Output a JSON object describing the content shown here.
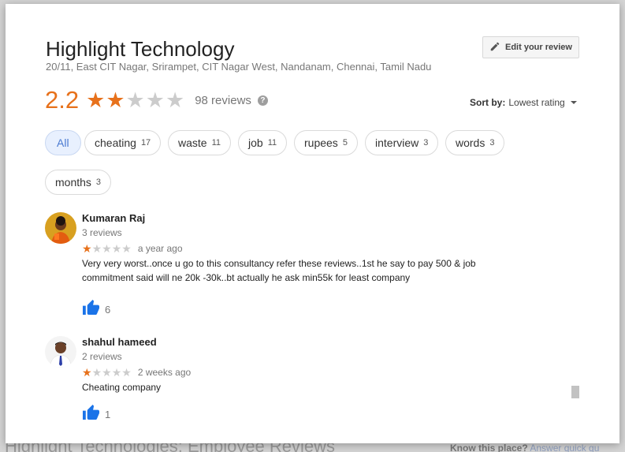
{
  "background": {
    "title": "Highlight Technologies: Employee Reviews ...",
    "know_label": "Know this place?",
    "know_link": "Answer quick qu"
  },
  "business": {
    "name": "Highlight Technology",
    "address": "20/11, East CIT Nagar, Srirampet, CIT Nagar West, Nandanam, Chennai, Tamil Nadu",
    "rating": "2.2",
    "rating_value": 2.2,
    "review_count": "98 reviews"
  },
  "edit_button": {
    "label": "Edit your review",
    "icon": "pencil-icon"
  },
  "sort": {
    "label": "Sort by:",
    "value": "Lowest rating"
  },
  "colors": {
    "star": "#e7711b",
    "star_empty": "#cccccc",
    "like": "#1a73e8",
    "chip_active": "#4a7ad1"
  },
  "filters": [
    {
      "label": "All",
      "count": ""
    },
    {
      "label": "cheating",
      "count": "17"
    },
    {
      "label": "waste",
      "count": "11"
    },
    {
      "label": "job",
      "count": "11"
    },
    {
      "label": "rupees",
      "count": "5"
    },
    {
      "label": "interview",
      "count": "3"
    },
    {
      "label": "words",
      "count": "3"
    },
    {
      "label": "months",
      "count": "3"
    }
  ],
  "reviews": [
    {
      "author": "Kumaran Raj",
      "author_reviews": "3 reviews",
      "stars": 1,
      "time": "a year ago",
      "text": "Very very worst..once u go to this consultancy refer these reviews..1st he say to pay 500 & job commitment said will ne 20k -30k..bt actually he ask min55k for least company",
      "likes": "6"
    },
    {
      "author": "shahul hameed",
      "author_reviews": "2 reviews",
      "stars": 1,
      "time": "2 weeks ago",
      "text": "Cheating company",
      "likes": "1"
    }
  ]
}
